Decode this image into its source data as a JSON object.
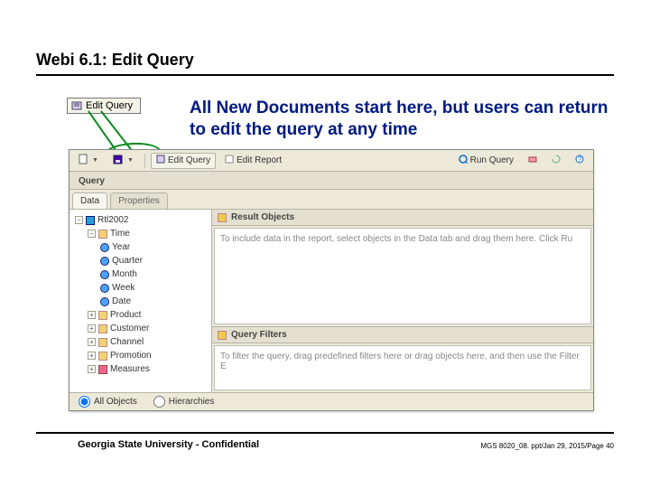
{
  "slide": {
    "title": "Webi 6.1: Edit Query"
  },
  "badge": {
    "label": "Edit Query"
  },
  "callout": "All New Documents start here, but users can return to edit the query at any time",
  "toolbar": {
    "new_doc_tip": "New",
    "save_tip": "Save",
    "edit_query_label": "Edit Query",
    "edit_report_label": "Edit Report",
    "run_query_label": "Run Query"
  },
  "query_strip": {
    "label": "Query"
  },
  "tabs": {
    "data": "Data",
    "properties": "Properties"
  },
  "tree": {
    "root": "Rtl2002",
    "time_folder": "Time",
    "time_children": [
      "Year",
      "Quarter",
      "Month",
      "Week",
      "Date"
    ],
    "other_children": [
      "Product",
      "Customer",
      "Channel",
      "Promotion"
    ],
    "measures": "Measures"
  },
  "panes": {
    "result_title": "Result Objects",
    "result_hint": "To include data in the report, select objects in the Data tab and drag them here. Click Ru",
    "filter_title": "Query Filters",
    "filter_hint": "To filter the query, drag predefined filters here or drag objects here, and then use the Filter E"
  },
  "radio": {
    "all_objects": "All Objects",
    "hierarchies": "Hierarchies"
  },
  "footer": {
    "left": "Georgia State University - Confidential",
    "right": "MGS 8020_08. ppt/Jan 29, 2015/Page 40"
  }
}
